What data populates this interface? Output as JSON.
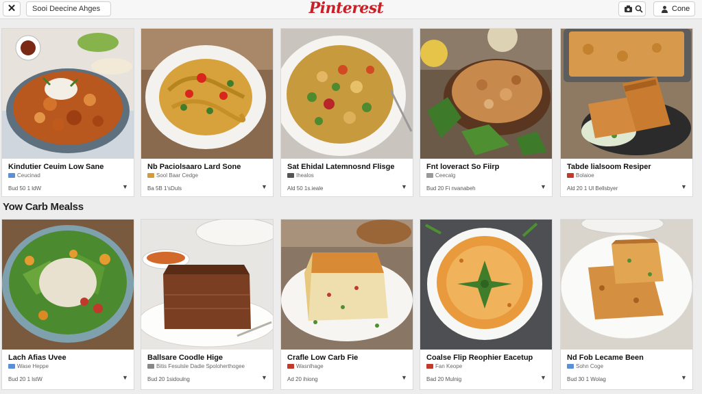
{
  "header": {
    "close_label": "✕",
    "search_value": "Sooi Deecine Ahges",
    "brand": "Pinterest",
    "done_label": "Cone"
  },
  "section": {
    "title": "Yow Carb Mealss"
  },
  "row1": [
    {
      "title": "Kindutier Ceuim Low Sane",
      "source": "Ceucinad",
      "meta": "Bud 50 1 ldW",
      "badge": "#5b8fd6"
    },
    {
      "title": "Nb Paciolsaaro Lard Sone",
      "source": "Sool Baar Cedge",
      "meta": "Ba 5B 1'sDuls",
      "badge": "#d69a3a"
    },
    {
      "title": "Sat Ehidal Latemnosnd Flisge",
      "source": "Ihealos",
      "meta": "Ald 50 1s.ieale",
      "badge": "#555555"
    },
    {
      "title": "Fnt loveract So Fiirp",
      "source": "Ceecalg",
      "meta": "Bud 20 Fi nvanabeh",
      "badge": "#999999"
    },
    {
      "title": "Tabde lialsoom Resiper",
      "source": "Bolaioe",
      "meta": "Ald 20 1 Ul Bellsbyer",
      "badge": "#c0392b"
    }
  ],
  "row2": [
    {
      "title": "Lach Afias Uvee",
      "source": "Wase Heppe",
      "meta": "Bud 20 1 lstW",
      "badge": "#5b8fd6"
    },
    {
      "title": "Ballsare Coodle Hige",
      "source": "Bitis Fesulsle Dadie Spoloherthogee",
      "meta": "Bud 20 1sidoulng",
      "badge": "#888888"
    },
    {
      "title": "Crafle Low Carb Fie",
      "source": "Wasnlhage",
      "meta": "Ad 20 ihiong",
      "badge": "#c0392b"
    },
    {
      "title": "Coalse Flip Reophier Eacetup",
      "source": "Fan Keope",
      "meta": "Bad 20 Mulnig",
      "badge": "#c0392b"
    },
    {
      "title": "Nd Fob Lecame Been",
      "source": "Sohn Coge",
      "meta": "Bud 30 1 Wolag",
      "badge": "#5b8fd6"
    }
  ]
}
